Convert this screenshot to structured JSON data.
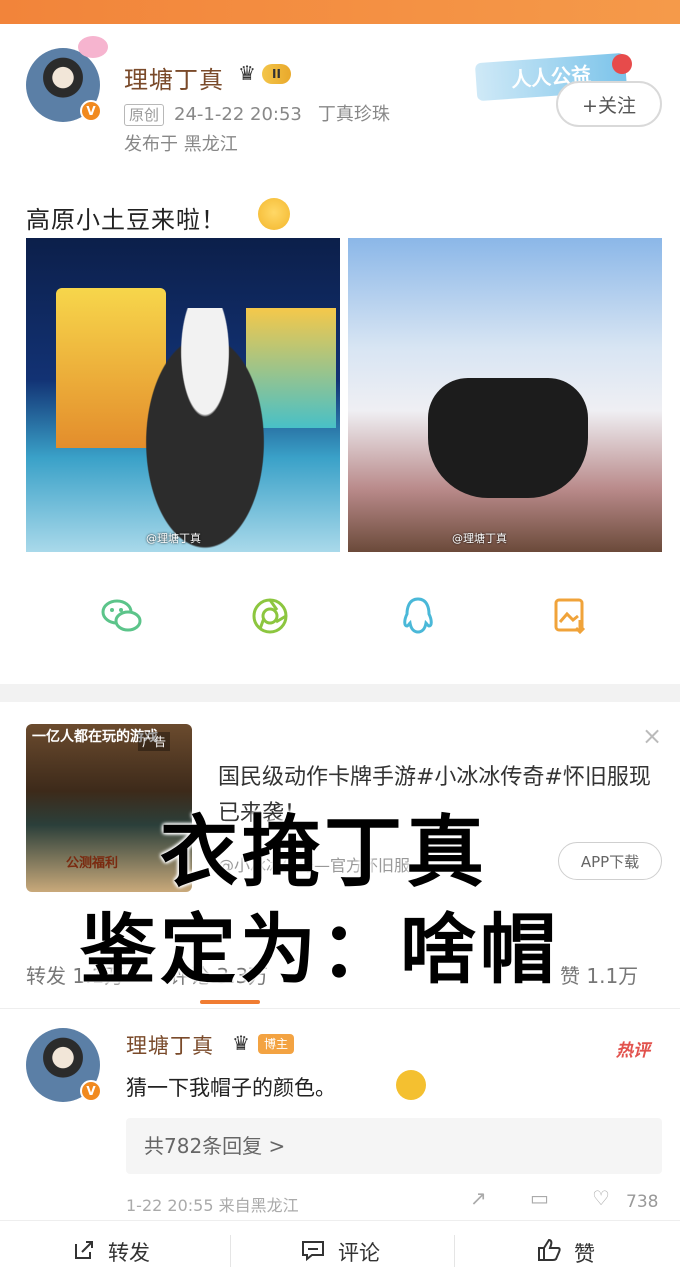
{
  "post": {
    "username": "理塘丁真",
    "level": "II",
    "original_tag": "原创",
    "timestamp": "24-1-22 20:53",
    "source": "丁真珍珠",
    "location": "发布于 黑龙江",
    "follow_label": "+关注",
    "sticker_text": "人人公益",
    "text": "高原小土豆来啦！",
    "photos": [
      {
        "watermark": "@理塘丁真"
      },
      {
        "watermark": "@理塘丁真"
      }
    ],
    "share_icons": [
      "wechat-icon",
      "moments-icon",
      "qq-icon",
      "save-image-icon"
    ]
  },
  "ad": {
    "thumb_top": "一亿人都在玩的游戏",
    "thumb_label": "广告",
    "thumb_bottom": "公测福利",
    "title": "国民级动作卡牌手游#小冰冰传奇#怀旧服现已来袭！",
    "sub": "@小冰冰传奇—官方怀旧服",
    "button": "APP下载"
  },
  "overlay": {
    "line1": "衣掩丁真",
    "line2": "鉴定为：啥帽"
  },
  "stats": {
    "repost": "转发 1.1万",
    "comment": "评论 3.3万",
    "like": "赞 1.1万"
  },
  "comment": {
    "username": "理塘丁真",
    "host_badge": "博主",
    "hot": "热评",
    "text": "猜一下我帽子的颜色。",
    "replies": "共782条回复 >",
    "footer": "1-22 20:55 来自黑龙江",
    "likes": "738"
  },
  "bottombar": {
    "repost": "转发",
    "comment": "评论",
    "like": "赞"
  },
  "colors": {
    "accent": "#f07c32",
    "username": "#7a4a2a",
    "share_green": "#5cc48a"
  }
}
